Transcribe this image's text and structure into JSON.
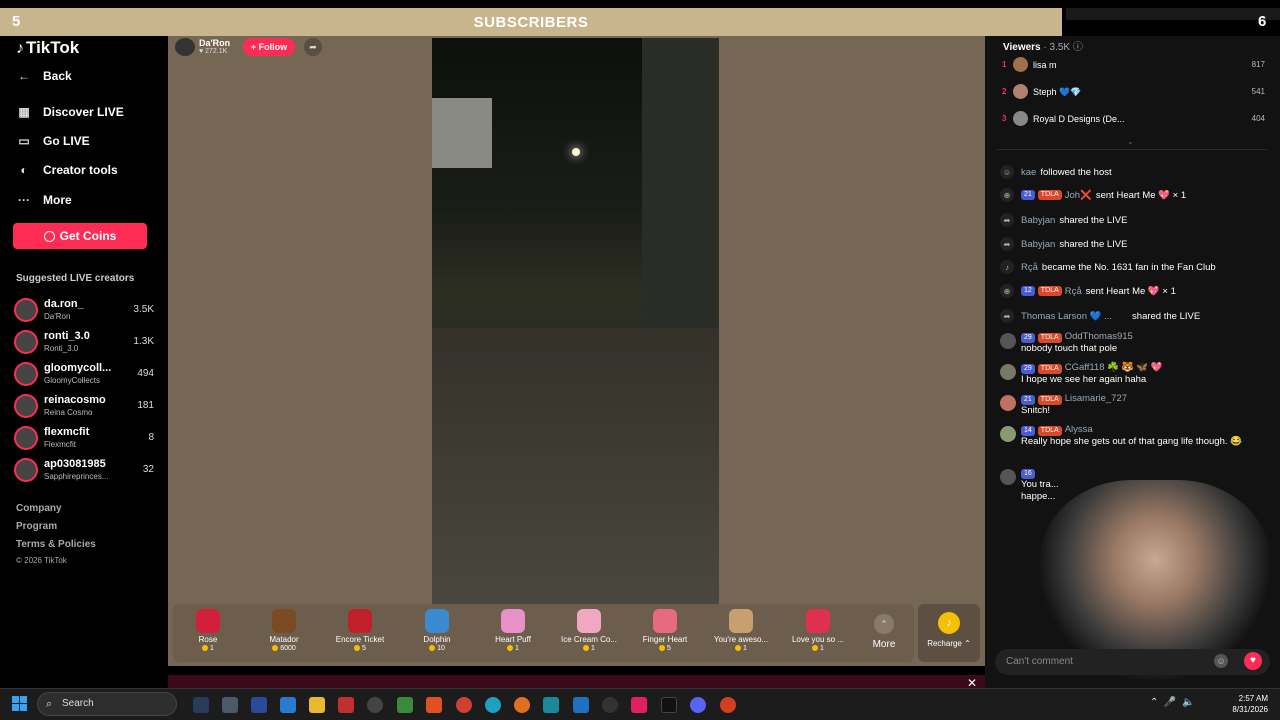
{
  "overlay": {
    "banner_title": "SUBSCRIBERS",
    "left_number": "5",
    "right_number": "6"
  },
  "sidebar": {
    "logo": "TikTok",
    "nav": [
      {
        "label": "Back",
        "icon": "arrow-left-icon"
      },
      {
        "label": "Discover LIVE",
        "icon": "calendar-icon"
      },
      {
        "label": "Go LIVE",
        "icon": "video-camera-icon"
      },
      {
        "label": "Creator tools",
        "icon": "lightbulb-icon"
      },
      {
        "label": "More",
        "icon": "ellipsis-icon"
      }
    ],
    "get_coins": "Get Coins",
    "suggested_title": "Suggested LIVE creators",
    "creators": [
      {
        "name": "da.ron_",
        "display": "Da'Ron",
        "count": "3.5K"
      },
      {
        "name": "ronti_3.0",
        "display": "Ronti_3.0",
        "count": "1.3K"
      },
      {
        "name": "gloomycoll...",
        "display": "GloomyCollects",
        "count": "494"
      },
      {
        "name": "reinacosmo",
        "display": "Reina Cosmo",
        "count": "181"
      },
      {
        "name": "flexmcfit",
        "display": "Flexmcfit",
        "count": "8"
      },
      {
        "name": "ap03081985",
        "display": "Sapphireprinces...",
        "count": "32"
      }
    ],
    "footer": [
      "Company",
      "Program",
      "Terms & Policies",
      "© 2026 TikTok"
    ]
  },
  "stream": {
    "host_name": "Da'Ron",
    "host_likes": "272.1K",
    "follow_label": "Follow"
  },
  "gifts": [
    {
      "name": "Rose",
      "price": "1",
      "color": "#d2203c"
    },
    {
      "name": "Matador",
      "price": "6000",
      "color": "#7a4a24"
    },
    {
      "name": "Encore Ticket",
      "price": "5",
      "color": "#c0202a"
    },
    {
      "name": "Dolphin",
      "price": "10",
      "color": "#3a8ad0"
    },
    {
      "name": "Heart Puff",
      "price": "1",
      "color": "#e890c8"
    },
    {
      "name": "Ice Cream Co...",
      "price": "1",
      "color": "#f0a8c0"
    },
    {
      "name": "Finger Heart",
      "price": "5",
      "color": "#e86a80"
    },
    {
      "name": "You're aweso...",
      "price": "1",
      "color": "#c8a070"
    },
    {
      "name": "Love you so ...",
      "price": "1",
      "color": "#e03050"
    }
  ],
  "gift_more_label": "More",
  "recharge_label": "Recharge",
  "viewers": {
    "title": "Viewers",
    "count": "3.5K",
    "top": [
      {
        "rank": "1",
        "name": "lisa m",
        "score": "817"
      },
      {
        "rank": "2",
        "name": "Steph 💙💎",
        "score": "541"
      },
      {
        "rank": "3",
        "name": "Royal D Designs (De...",
        "score": "404"
      }
    ]
  },
  "events": [
    {
      "icon": "person-icon",
      "user": "kae",
      "text": "followed the host",
      "badges": []
    },
    {
      "icon": "gift-icon",
      "user": "Joh❌",
      "text": "sent Heart Me 💖 × 1",
      "badges": [
        "21",
        "TDLA"
      ]
    },
    {
      "icon": "share-icon",
      "user": "Babyjan",
      "text": "shared the LIVE",
      "badges": []
    },
    {
      "icon": "share-icon",
      "user": "Babyjan",
      "text": "shared the LIVE",
      "badges": []
    },
    {
      "icon": "tiktok-icon",
      "user": "Rçå",
      "text": "became the No. 1631 fan in the Fan Club",
      "badges": []
    },
    {
      "icon": "gift-icon",
      "user": "Rçå",
      "text": "sent Heart Me 💖 × 1",
      "badges": [
        "12",
        "TDLA"
      ]
    },
    {
      "icon": "share-icon",
      "user": "Thomas Larson 💙 ...",
      "text": "shared the LIVE",
      "badges": []
    }
  ],
  "comments": [
    {
      "user": "OddThomas915",
      "badge": "29",
      "text": "nobody touch that pole"
    },
    {
      "user": "CGaff118 ☘️ 🐯 🦋 💖",
      "badge": "29",
      "text": "I hope we see her again haha"
    },
    {
      "user": "Lisamarie_727",
      "badge": "21",
      "text": "Snitch!"
    },
    {
      "user": "Alyssa",
      "badge": "14",
      "text": "Really hope she gets out of that gang life though. 😂"
    },
    {
      "user": "",
      "badge": "16",
      "text": "You tra... happe..."
    }
  ],
  "comment_placeholder": "Can't comment",
  "taskbar": {
    "search_label": "Search",
    "time": "2:57 AM",
    "date": "8/31/2026"
  }
}
